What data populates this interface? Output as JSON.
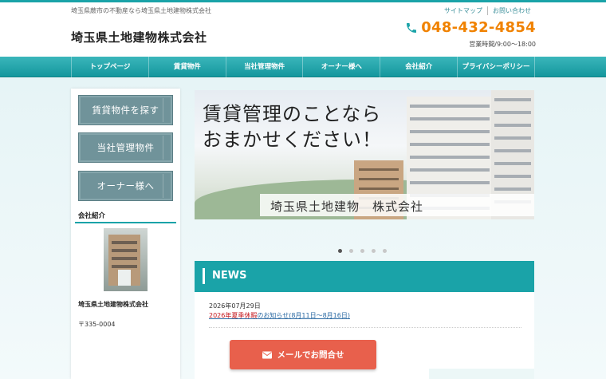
{
  "header": {
    "tagline": "埼玉県蕨市の不動産なら埼玉県土地建物株式会社",
    "company_name": "埼玉県土地建物株式会社",
    "links": [
      "サイトマップ",
      "お問い合わせ"
    ],
    "phone": "048-432-4854",
    "hours": "営業時間/9:00～18:00"
  },
  "nav": {
    "items": [
      "トップページ",
      "賃貸物件",
      "当社管理物件",
      "オーナー様へ",
      "会社紹介",
      "プライバシーポリシー"
    ]
  },
  "sidebar": {
    "buttons": [
      "賃貸物件を探す",
      "当社管理物件",
      "オーナー様へ"
    ],
    "section_heading": "会社紹介",
    "company_name": "埼玉県土地建物株式会社",
    "postal": "〒335-0004"
  },
  "hero": {
    "line1": "賃貸管理のことなら",
    "line2": "おまかせください！",
    "company": "埼玉県土地建物　株式会社",
    "slide_count": 5,
    "active_slide": 1
  },
  "news": {
    "title": "NEWS",
    "date": "2026年07月29日",
    "link_highlight": "2026年夏季休暇",
    "link_rest": "のお知らせ(8月11日～8月16日)"
  },
  "cta": {
    "mail_label": "メールでお問合せ"
  },
  "colors": {
    "accent": "#1aa3a8",
    "phone": "#f08200",
    "cta": "#e8604c",
    "side_button": "#70939a"
  }
}
